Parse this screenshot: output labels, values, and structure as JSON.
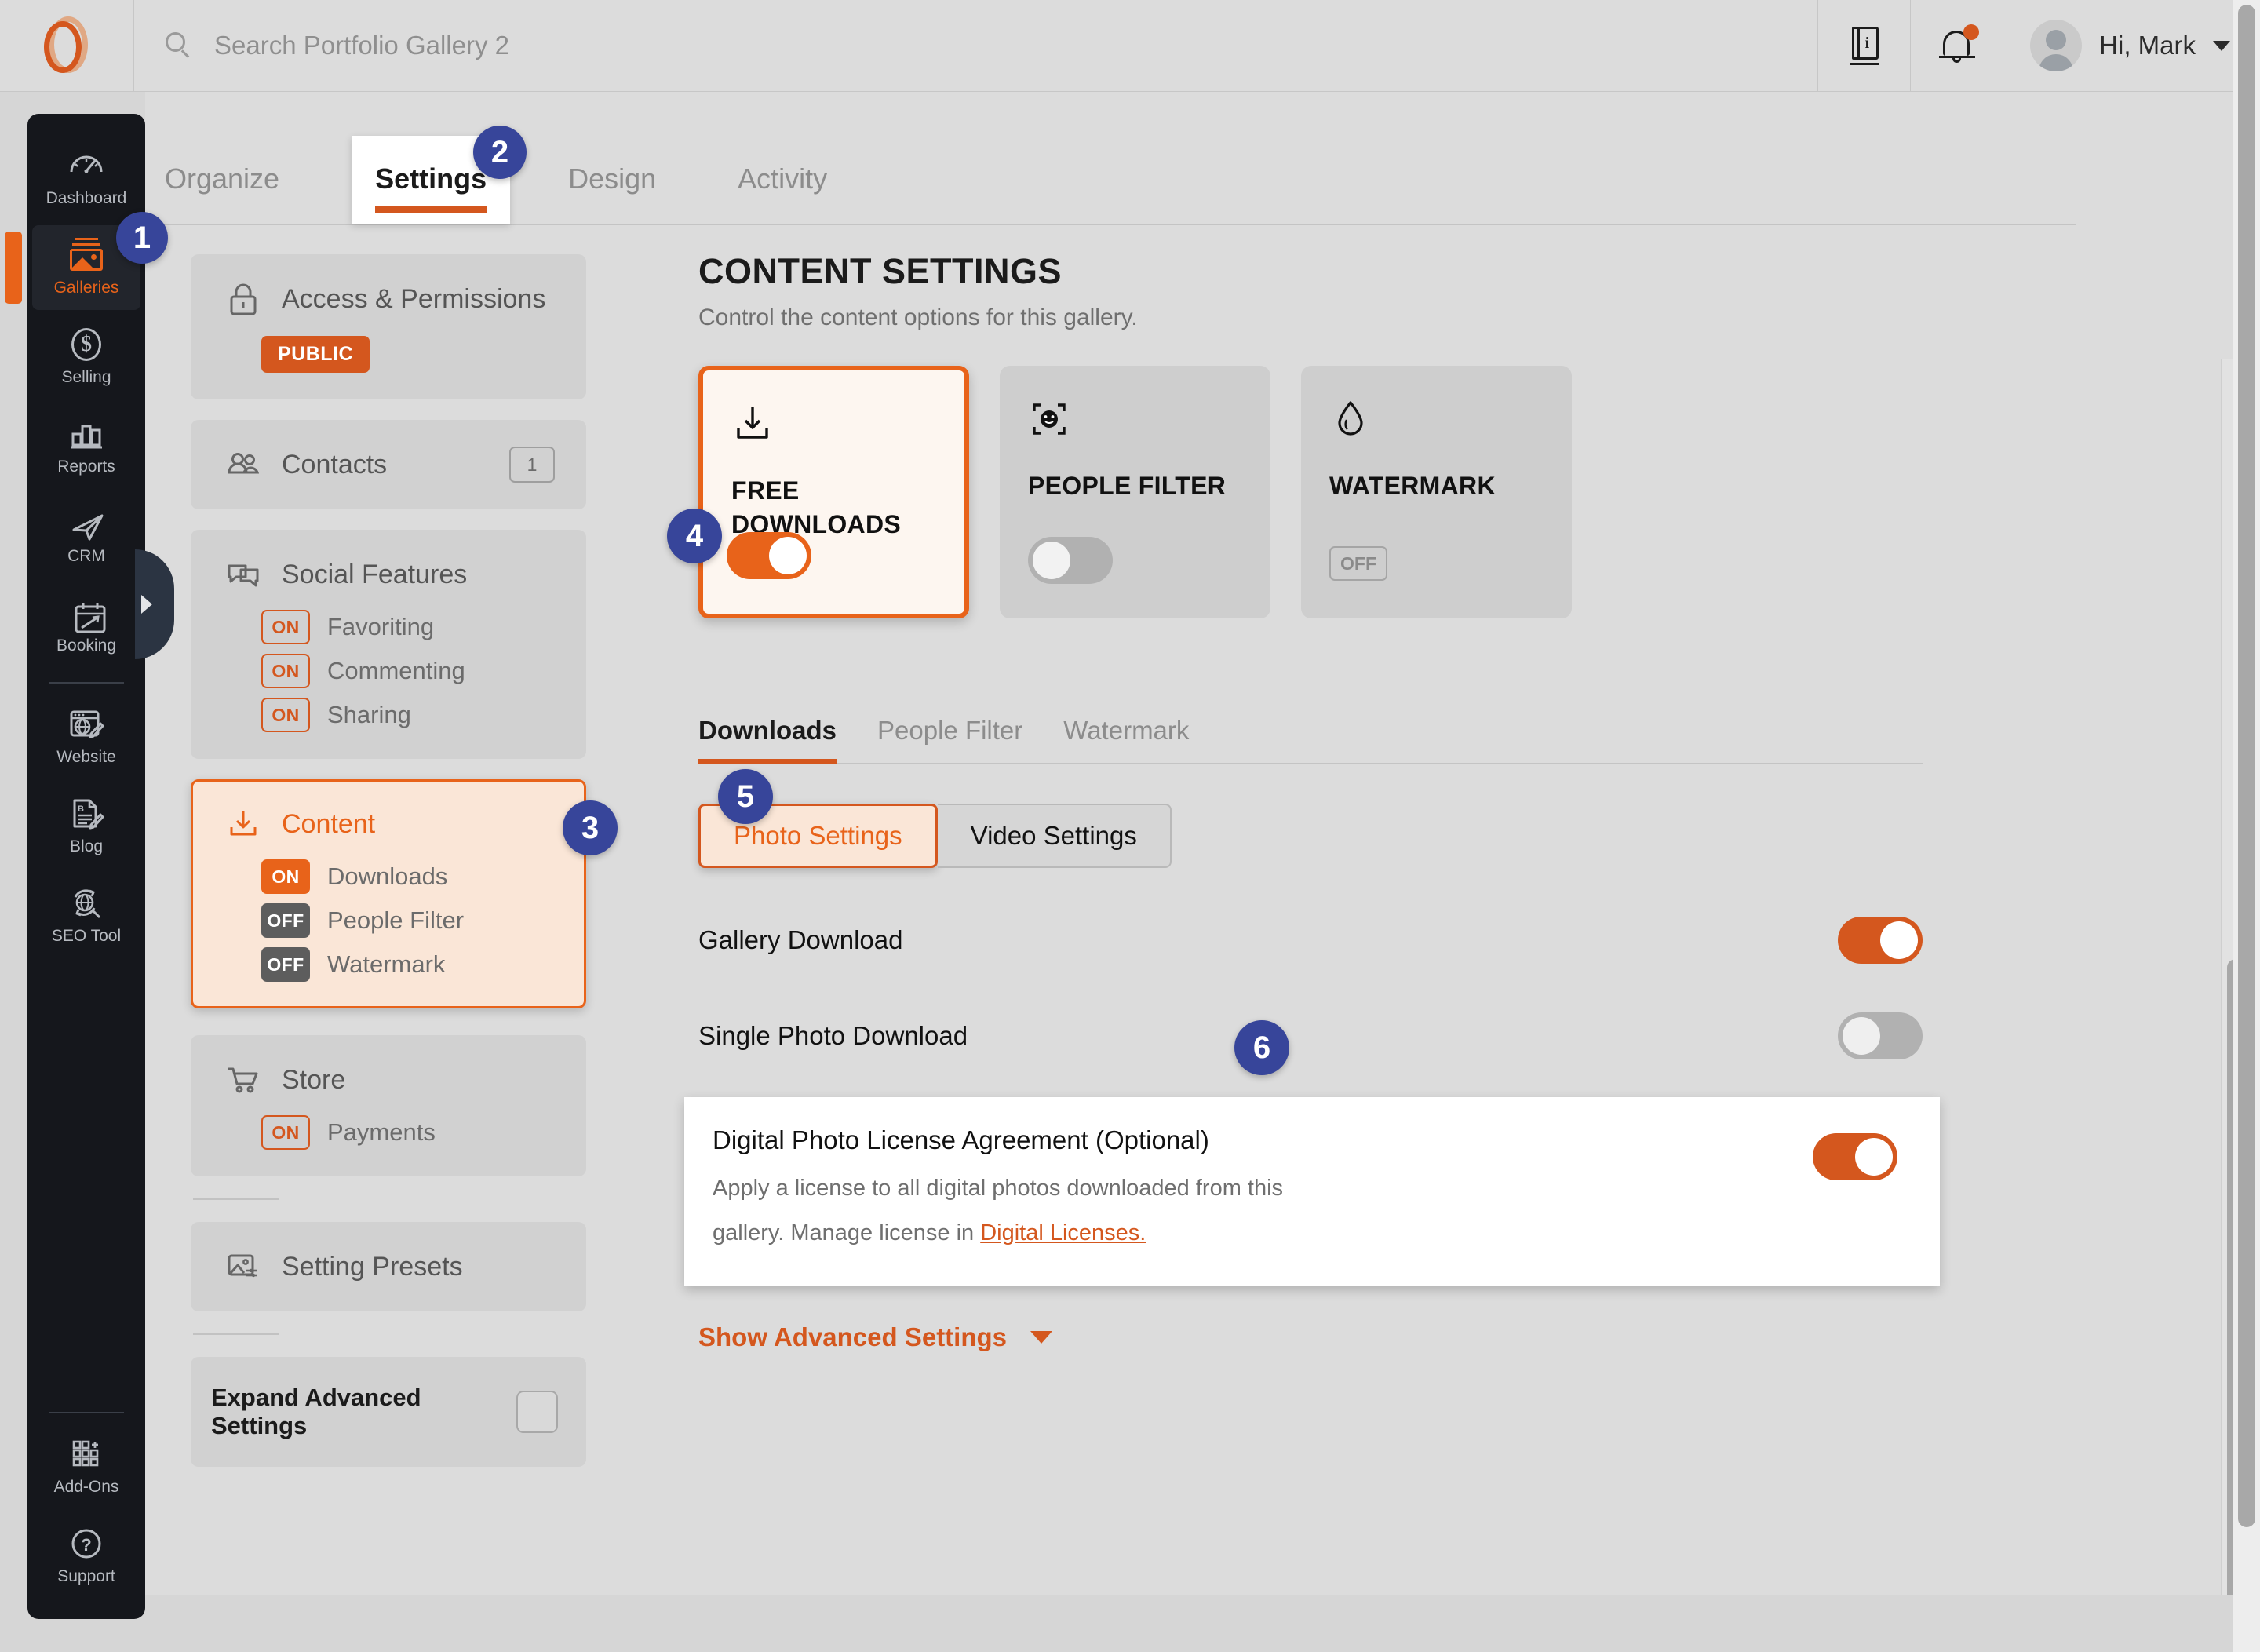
{
  "topbar": {
    "logo_name": "portfolio-logo",
    "search_placeholder": "Search Portfolio Gallery 2",
    "help_icon": "book-info-icon",
    "notifications_icon": "bell-icon",
    "avatar_icon": "user-avatar",
    "greeting": "Hi, Mark"
  },
  "sidebar": {
    "items": [
      {
        "label": "Dashboard",
        "icon": "speedometer-icon",
        "active": false
      },
      {
        "label": "Galleries",
        "icon": "photo-gallery-icon",
        "active": true
      },
      {
        "label": "Selling",
        "icon": "dollar-circle-icon",
        "active": false
      },
      {
        "label": "Reports",
        "icon": "bar-chart-icon",
        "active": false
      },
      {
        "label": "CRM",
        "icon": "paper-plane-icon",
        "active": false
      },
      {
        "label": "Booking",
        "icon": "calendar-arrow-icon",
        "active": false
      },
      {
        "label": "Website",
        "icon": "browser-globe-pencil-icon",
        "active": false
      },
      {
        "label": "Blog",
        "icon": "document-pencil-icon",
        "active": false
      },
      {
        "label": "SEO Tool",
        "icon": "globe-refresh-icon",
        "active": false
      }
    ],
    "bottom_items": [
      {
        "label": "Add-Ons",
        "icon": "grid-plus-icon"
      },
      {
        "label": "Support",
        "icon": "question-circle-icon"
      }
    ],
    "expand_handle_icon": "chevron-right-icon"
  },
  "tabs": [
    {
      "label": "Organize",
      "active": false
    },
    {
      "label": "Settings",
      "active": true
    },
    {
      "label": "Design",
      "active": false
    },
    {
      "label": "Activity",
      "active": false
    }
  ],
  "settings_panel": {
    "access": {
      "title": "Access & Permissions",
      "icon": "lock-icon",
      "badge": "PUBLIC"
    },
    "contacts": {
      "title": "Contacts",
      "icon": "people-icon",
      "count": "1"
    },
    "social": {
      "title": "Social Features",
      "icon": "chat-bubbles-icon",
      "items": [
        {
          "state": "ON",
          "label": "Favoriting"
        },
        {
          "state": "ON",
          "label": "Commenting"
        },
        {
          "state": "ON",
          "label": "Sharing"
        }
      ]
    },
    "content": {
      "title": "Content",
      "icon": "download-icon",
      "items": [
        {
          "state": "ON",
          "label": "Downloads"
        },
        {
          "state": "OFF",
          "label": "People Filter"
        },
        {
          "state": "OFF",
          "label": "Watermark"
        }
      ]
    },
    "store": {
      "title": "Store",
      "icon": "shopping-cart-icon",
      "items": [
        {
          "state": "ON",
          "label": "Payments"
        }
      ]
    },
    "presets": {
      "title": "Setting Presets",
      "icon": "image-sliders-icon"
    },
    "expand_advanced": {
      "label": "Expand Advanced Settings",
      "checkbox_icon": "checkbox-unchecked"
    }
  },
  "main": {
    "title": "CONTENT SETTINGS",
    "subtitle": "Control the content options for this gallery.",
    "feature_cards": [
      {
        "title": "FREE DOWNLOADS",
        "icon": "download-icon",
        "control": "toggle",
        "state": "on",
        "selected": true
      },
      {
        "title": "PEOPLE FILTER",
        "icon": "face-scan-icon",
        "control": "toggle",
        "state": "off",
        "selected": false
      },
      {
        "title": "WATERMARK",
        "icon": "water-drop-icon",
        "control": "badge",
        "state": "OFF",
        "selected": false
      }
    ],
    "subtabs": [
      {
        "label": "Downloads",
        "active": true
      },
      {
        "label": "People Filter",
        "active": false
      },
      {
        "label": "Watermark",
        "active": false
      }
    ],
    "segmented": [
      {
        "label": "Photo Settings",
        "active": true
      },
      {
        "label": "Video Settings",
        "active": false
      }
    ],
    "rows": [
      {
        "label": "Gallery Download",
        "state": "on"
      },
      {
        "label": "Single Photo Download",
        "state": "off"
      }
    ],
    "license": {
      "title": "Digital Photo License Agreement (Optional)",
      "desc_part1": "Apply a license to all digital photos downloaded from this gallery. Manage license in ",
      "link": "Digital Licenses.",
      "state": "on"
    },
    "advanced": {
      "label": "Show Advanced Settings",
      "icon": "chevron-down-icon"
    }
  },
  "callouts": [
    {
      "number": "1"
    },
    {
      "number": "2"
    },
    {
      "number": "3"
    },
    {
      "number": "4"
    },
    {
      "number": "5"
    },
    {
      "number": "6"
    }
  ],
  "colors": {
    "accent_orange": "#d4571e",
    "bright_orange": "#e8631a",
    "callout_blue": "#37459a",
    "nav_dark": "#15171c",
    "page_bg": "#d6d6d6"
  }
}
